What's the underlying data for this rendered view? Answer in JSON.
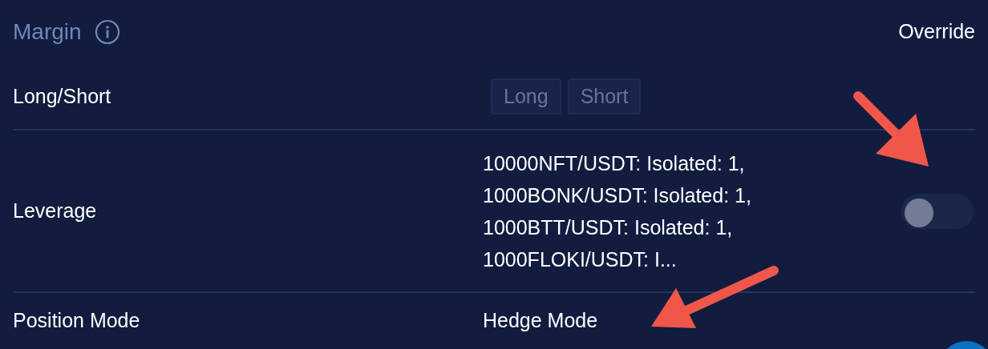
{
  "section": {
    "title": "Margin",
    "action": "Override"
  },
  "rows": [
    {
      "kind": "choice",
      "label": "Long/Short",
      "options": [
        {
          "label": "Long",
          "selected": false,
          "disabled": true
        },
        {
          "label": "Short",
          "selected": false,
          "disabled": true
        }
      ]
    },
    {
      "kind": "toggle",
      "label": "Leverage",
      "lines": [
        "10000NFT/USDT: Isolated: 1,",
        "1000BONK/USDT: Isolated: 1,",
        "1000BTT/USDT: Isolated: 1,",
        "1000FLOKI/USDT: I..."
      ],
      "on": false
    },
    {
      "kind": "value",
      "label": "Position Mode",
      "value": "Hedge Mode"
    }
  ]
}
